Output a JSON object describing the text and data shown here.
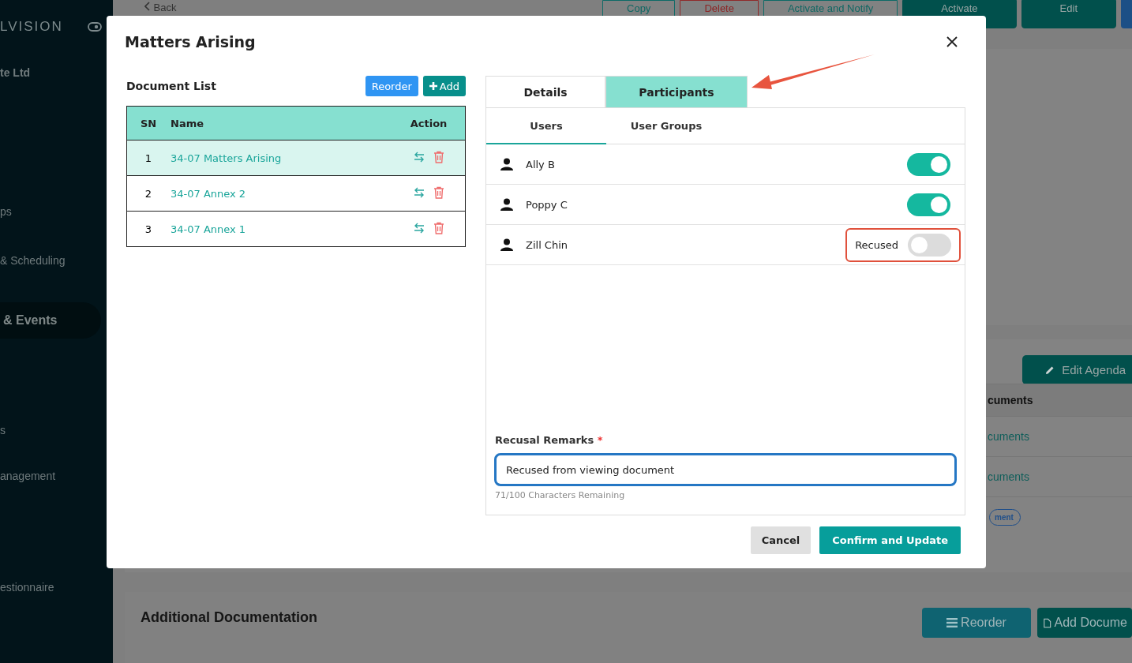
{
  "background": {
    "sidebar": {
      "brand": "LVISION",
      "org": "te Ltd",
      "items": [
        {
          "label": "ps",
          "selected": false
        },
        {
          "label": "& Scheduling",
          "selected": false
        },
        {
          "label": "& Events",
          "selected": true
        },
        {
          "label": "s",
          "selected": false
        },
        {
          "label": "anagement",
          "selected": false
        },
        {
          "label": "estionnaire",
          "selected": false
        }
      ]
    },
    "toolbar": {
      "back": "Back",
      "buttons": [
        {
          "label": "Copy",
          "kind": "outline-teal"
        },
        {
          "label": "Delete",
          "kind": "outline-red"
        },
        {
          "label": "Activate and Notify",
          "kind": "outline-teal"
        },
        {
          "label": "Activate",
          "kind": "solid"
        },
        {
          "label": "Edit",
          "kind": "solid"
        }
      ]
    },
    "agenda": {
      "edit_button": "Edit Agenda",
      "column_header": "cuments",
      "cells": [
        {
          "text": "cuments",
          "kind": "link"
        },
        {
          "text": "cuments",
          "kind": "link"
        },
        {
          "text": "ment",
          "kind": "badge"
        }
      ]
    },
    "additional": {
      "title": "Additional Documentation",
      "buttons": [
        "Reorder",
        "Add Docume"
      ]
    }
  },
  "modal": {
    "title": "Matters Arising",
    "document_list": {
      "title": "Document List",
      "reorder": "Reorder",
      "add": "Add",
      "columns": [
        "SN",
        "Name",
        "Action"
      ],
      "rows": [
        {
          "sn": "1",
          "name": "34-07 Matters Arising",
          "selected": true
        },
        {
          "sn": "2",
          "name": "34-07 Annex 2",
          "selected": false
        },
        {
          "sn": "3",
          "name": "34-07 Annex 1",
          "selected": false
        }
      ]
    },
    "tabs": [
      {
        "label": "Details",
        "selected": false,
        "arrow": false
      },
      {
        "label": "Participants",
        "selected": true,
        "arrow": true
      }
    ],
    "subtabs": [
      {
        "label": "Users",
        "selected": true
      },
      {
        "label": "User Groups",
        "selected": false
      }
    ],
    "users": [
      {
        "name": "Ally B",
        "on": true,
        "highlighted": false
      },
      {
        "name": "Poppy C",
        "on": true,
        "highlighted": false
      },
      {
        "name": "Zill Chin",
        "on": false,
        "status": "Recused",
        "highlighted": true
      }
    ],
    "remarks": {
      "label": "Recusal Remarks",
      "required_mark": "*",
      "value": "Recused from viewing document",
      "counter": "71/100 Characters Remaining"
    },
    "buttons": {
      "cancel": "Cancel",
      "confirm": "Confirm and Update"
    }
  }
}
